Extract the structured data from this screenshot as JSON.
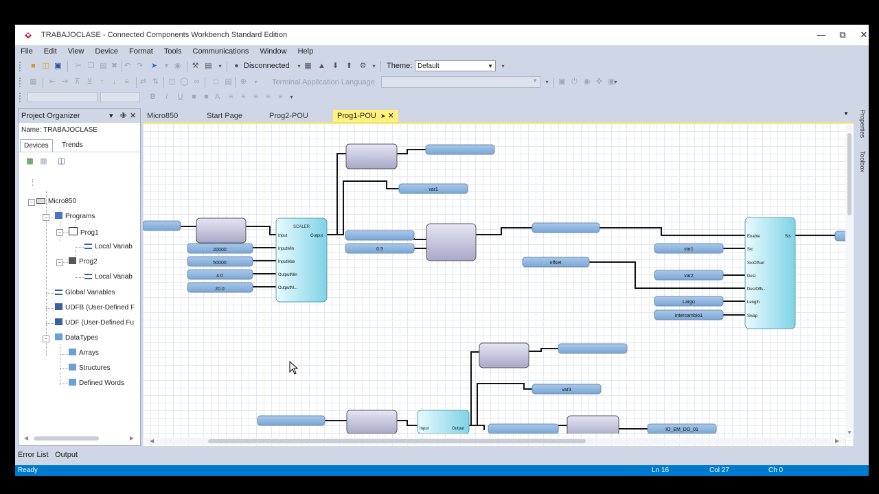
{
  "window": {
    "title": "TRABAJOCLASE - Connected Components Workbench Standard Edition"
  },
  "menu": [
    "File",
    "Edit",
    "View",
    "Device",
    "Format",
    "Tools",
    "Communications",
    "Window",
    "Help"
  ],
  "toolbar": {
    "connection": "Disconnected",
    "theme_label": "Theme:",
    "theme_value": "Default",
    "terminal_language_label": "Terminal Application Language"
  },
  "organizer": {
    "title": "Project Organizer",
    "name_label": "Name:",
    "name": "TRABAJOCLASE",
    "tabs": [
      "Devices",
      "Trends"
    ],
    "tree": {
      "root": "Micro850",
      "programs": "Programs",
      "prog1": "Prog1",
      "prog1_vars": "Local Variab",
      "prog2": "Prog2",
      "prog2_vars": "Local Variab",
      "global": "Global Variables",
      "udfb": "UDFB (User-Defined F",
      "udf": "UDF (User-Defined Fu",
      "datatypes": "DataTypes",
      "arrays": "Arrays",
      "structures": "Structures",
      "defined_words": "Defined Words"
    }
  },
  "doc_tabs": [
    "Micro850",
    "Start Page",
    "Prog2-POU",
    "Prog1-POU"
  ],
  "active_tab": "Prog1-POU",
  "side_panels": [
    "Properties",
    "Toolbox"
  ],
  "bottom_tabs": [
    "Error List",
    "Output"
  ],
  "status": {
    "ready": "Ready",
    "ln": "Ln 16",
    "col": "Col 27",
    "ch": "Ch 0"
  },
  "diagram": {
    "scale_pins": {
      "in": [
        "Input",
        "InputMin",
        "InputMax",
        "OutputMin",
        "OutputM..."
      ],
      "out": [
        "Output"
      ]
    },
    "scale_header": "SCALER",
    "scale2_pins": [
      "Input",
      "Output"
    ],
    "inputs1": [
      "20000",
      "50000",
      "4.0",
      "20.0"
    ],
    "top_var": "var1",
    "mid_var": "0.5",
    "offset_var": "offset",
    "cop_pins": [
      "Enable",
      "Src",
      "SrcOffset",
      "Dest",
      "DestOffs...",
      "Length",
      "Swap"
    ],
    "cop_out": "Sts",
    "cop_inputs": [
      "var1",
      "var2",
      "Largo",
      "intercambio1"
    ],
    "lower_var": "var3",
    "lower_out": "IO_EM_DO_01"
  }
}
